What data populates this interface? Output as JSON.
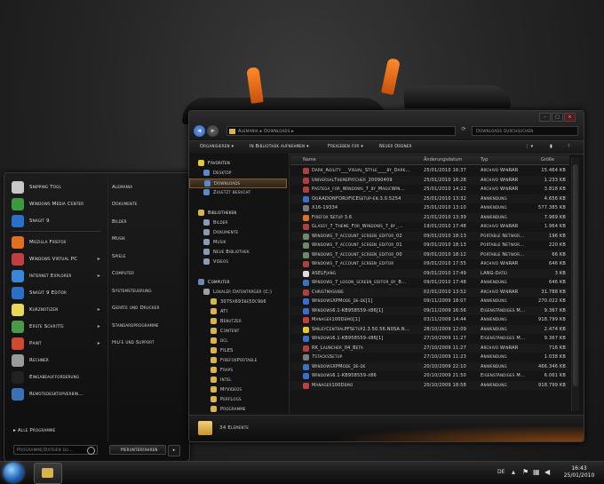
{
  "start_menu": {
    "left_items": [
      {
        "label": "Snipping Tool",
        "color": "#c8c8c8",
        "arrow": false
      },
      {
        "label": "Windows Media Center",
        "color": "#3a9b3a",
        "arrow": false
      },
      {
        "label": "Snagit 9",
        "color": "#2a70c8",
        "arrow": false
      },
      {
        "label": "Mozilla Firefox",
        "color": "#e07020",
        "arrow": false
      },
      {
        "label": "Windows Virtual PC",
        "color": "#c04040",
        "arrow": true
      },
      {
        "label": "Internet Explorer",
        "color": "#3a86d8",
        "arrow": true
      },
      {
        "label": "Snagit 9 Editor",
        "color": "#2a70c8",
        "arrow": false
      },
      {
        "label": "Kurznotizen",
        "color": "#e8d85a",
        "arrow": true
      },
      {
        "label": "Erste Schritte",
        "color": "#4a9a4a",
        "arrow": true
      },
      {
        "label": "Paint",
        "color": "#d04a30",
        "arrow": true
      },
      {
        "label": "Rechner",
        "color": "#9a9a9a",
        "arrow": false
      },
      {
        "label": "Eingabeaufforderung",
        "color": "#222222",
        "arrow": false
      },
      {
        "label": "Remotedesktopverbin...",
        "color": "#3a70b8",
        "arrow": false
      }
    ],
    "right_items": [
      "Alemania",
      "Dokumente",
      "Bilder",
      "Musik",
      "Spiele",
      "Computer",
      "Systemsteuerung",
      "Geräte und Drucker",
      "Standardprogramme",
      "Hilfe und Support"
    ],
    "all_programs": "Alle Programme",
    "search_placeholder": "Programme/Dateien du...",
    "shutdown_label": "Herunterfahren"
  },
  "explorer": {
    "breadcrumb": [
      "Alemania",
      "Downloads"
    ],
    "search_placeholder": "Downloads durchsuchen",
    "toolbar": {
      "organize": "Organisieren ▾",
      "include_library": "In Bibliothek aufnehmen ▾",
      "share": "Freigeben für ▾",
      "new_folder": "Neuer Ordner"
    },
    "nav": {
      "favorites_header": "Favoriten",
      "favorites": [
        "Desktop",
        "Downloads",
        "Zuletzt besucht"
      ],
      "libraries_header": "Bibliotheken",
      "libraries": [
        "Bilder",
        "Dokumente",
        "Musik",
        "Neue Bibliothek",
        "Videos"
      ],
      "computer_header": "Computer",
      "drive": "Lokaler Datenträger (C:)",
      "folders": [
        "3075a693be50c9b6",
        "ATI",
        "Benutzer",
        "Content",
        "dcl",
        "FILES",
        "FirefoxPortable",
        "Fraps",
        "Intel",
        "MyVideos",
        "PerfLogs",
        "Programme"
      ]
    },
    "columns": {
      "name": "Name",
      "date": "Änderungsdatum",
      "type": "Typ",
      "size": "Größe"
    },
    "files": [
      {
        "name": "Dark_Agility___Visual_Style____by_Dark...",
        "date": "25/01/2010 16:37",
        "type": "Archivo WinRAR",
        "size": "15.464 KB",
        "color": "#b04040"
      },
      {
        "name": "UniversalThemePatcher_20090409",
        "date": "25/01/2010 16:28",
        "type": "Archivo WinRAR",
        "size": "1.233 KB",
        "color": "#b04040"
      },
      {
        "name": "Pastega_for_Windows_7_by_MagicWin...",
        "date": "25/01/2010 14:22",
        "type": "Archivo WinRAR",
        "size": "3.818 KB",
        "color": "#b04040"
      },
      {
        "name": "OoAADONFORoFICEsetup-en.3.0.5254",
        "date": "25/01/2010 13:32",
        "type": "Anwendung",
        "size": "4.656 KB",
        "color": "#3a70c8"
      },
      {
        "name": "X16-19334",
        "date": "25/01/2010 13:10",
        "type": "Anwendung",
        "size": "577.385 KB",
        "color": "#7a7a7a"
      },
      {
        "name": "Firefox Setup 3.6",
        "date": "21/01/2010 13:39",
        "type": "Anwendung",
        "size": "7.969 KB",
        "color": "#e07020"
      },
      {
        "name": "Glassy_7_Theme_For_Windows_7_by_...",
        "date": "19/01/2010 17:48",
        "type": "Archivo WinRAR",
        "size": "1.964 KB",
        "color": "#b04040"
      },
      {
        "name": "Windows_7_account_screen_editor_02",
        "date": "09/01/2010 18:13",
        "type": "Portable Networ...",
        "size": "196 KB",
        "color": "#6a8a6a"
      },
      {
        "name": "Windows_7_account_screen_editor_01",
        "date": "09/01/2010 18:13",
        "type": "Portable Networ...",
        "size": "220 KB",
        "color": "#6a8a6a"
      },
      {
        "name": "Windows_7_account_screen_editor_00",
        "date": "09/01/2010 18:12",
        "type": "Portable Networ...",
        "size": "66 KB",
        "color": "#6a8a6a"
      },
      {
        "name": "Windows_7_account_screen_editor",
        "date": "09/01/2010 17:55",
        "type": "Archivo WinRAR",
        "size": "646 KB",
        "color": "#b04040"
      },
      {
        "name": "ASELFjang",
        "date": "09/01/2010 17:49",
        "type": "LANG-Datei",
        "size": "3 KB",
        "color": "#dddddd"
      },
      {
        "name": "Windows_7_logon_screen_editor_by_B...",
        "date": "09/01/2010 17:48",
        "type": "Anwendung",
        "size": "646 KB",
        "color": "#3a70c8"
      },
      {
        "name": "Christmasvibe",
        "date": "02/01/2010 13:52",
        "type": "Archivo WinRAR",
        "size": "31.788 KB",
        "color": "#b04040"
      },
      {
        "name": "WindowsXPMode_de-de[1]",
        "date": "09/11/2009 18:07",
        "type": "Anwendung",
        "size": "270.022 KB",
        "color": "#3a70c8"
      },
      {
        "name": "Windows6.1-KB958559-x86[1]",
        "date": "09/11/2009 16:56",
        "type": "Eigenständiges M...",
        "size": "9.367 KB",
        "color": "#3a70c8"
      },
      {
        "name": "Manager100Demo[1]",
        "date": "03/11/2009 14:44",
        "type": "Anwendung",
        "size": "918.799 KB",
        "color": "#c04040"
      },
      {
        "name": "SmileyCentralPFSetup2.3.50.56.N0SA.N...",
        "date": "28/10/2009 12:09",
        "type": "Anwendung",
        "size": "2.474 KB",
        "color": "#e8c830"
      },
      {
        "name": "Windows6.1-KB958559-x86[1]",
        "date": "27/10/2009 11:27",
        "type": "Eigenständiges M...",
        "size": "9.367 KB",
        "color": "#3a70c8"
      },
      {
        "name": "RK_Launcher_04_Beta",
        "date": "27/10/2009 11:27",
        "type": "Archivo WinRAR",
        "size": "716 KB",
        "color": "#b04040"
      },
      {
        "name": "7stacksSetup",
        "date": "27/10/2009 11:23",
        "type": "Anwendung",
        "size": "1.038 KB",
        "color": "#7a7a7a"
      },
      {
        "name": "WindowsXPMode_de-de",
        "date": "20/10/2009 22:10",
        "type": "Anwendung",
        "size": "466.346 KB",
        "color": "#3a70c8"
      },
      {
        "name": "Windows6.1-KB958559-x86",
        "date": "20/10/2009 21:50",
        "type": "Eigenständiges M...",
        "size": "6.061 KB",
        "color": "#3a70c8"
      },
      {
        "name": "Manager100Demo",
        "date": "20/10/2009 18:58",
        "type": "Anwendung",
        "size": "918.799 KB",
        "color": "#c04040"
      }
    ],
    "status": "34 Elemente"
  },
  "taskbar": {
    "language": "DE",
    "time": "16:43",
    "date": "25/01/2010"
  }
}
